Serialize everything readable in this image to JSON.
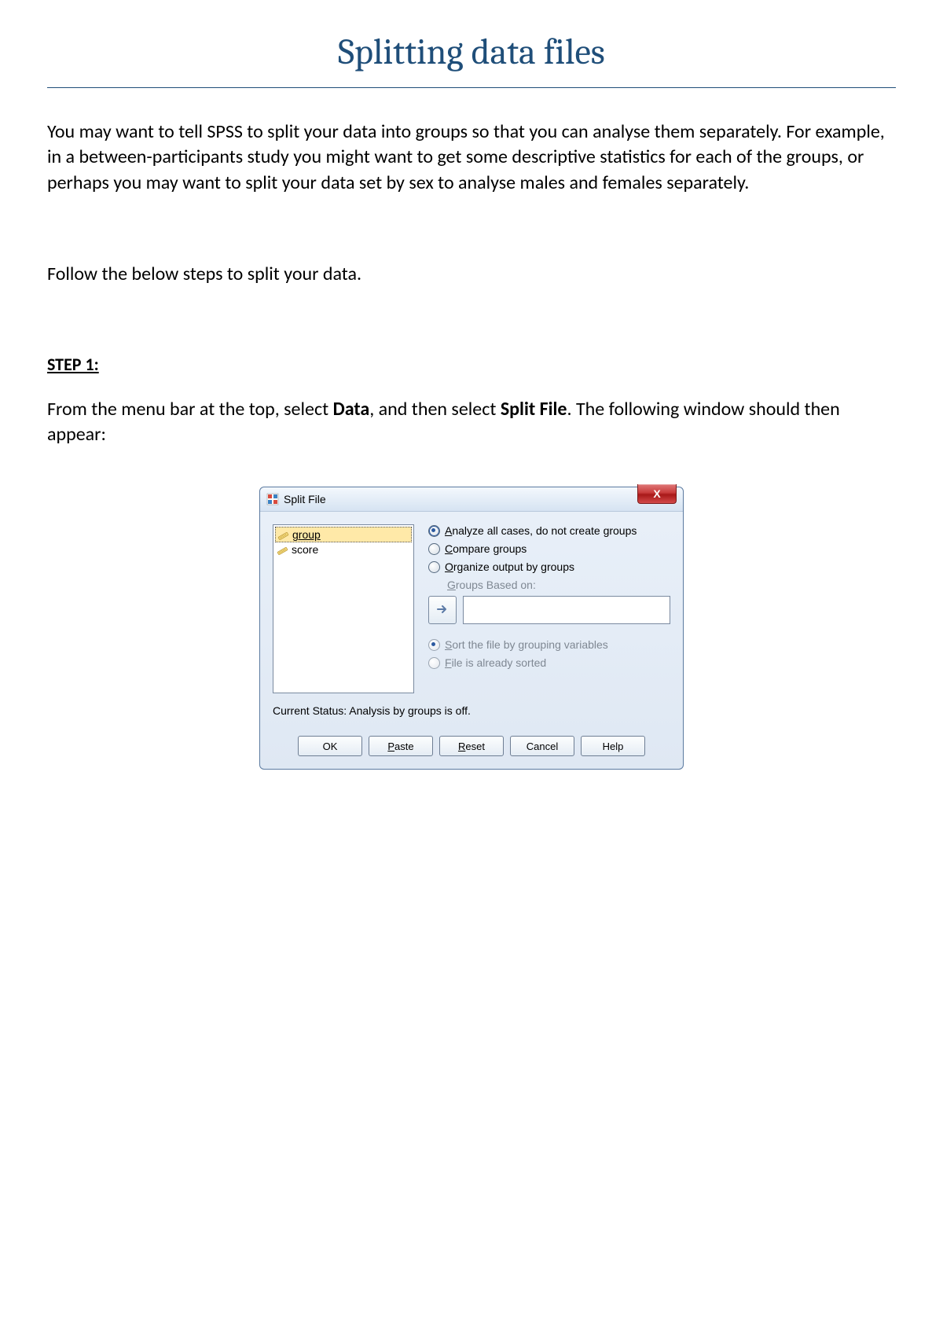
{
  "title": "Splitting data files",
  "intro_para": "You may want to tell SPSS to split your data into groups so that you can analyse them separately.  For example, in a between-participants study you might want to get some descriptive statistics for each of the groups, or perhaps you may want to split your data set by sex to analyse males and females separately.",
  "follow_para": "Follow the below steps to split your data.",
  "step1": {
    "heading": "STEP 1:",
    "body_pre": "From the menu bar at the top, select ",
    "bold1": "Data",
    "body_mid": ", and then select ",
    "bold2": "Split File",
    "body_post": ".  The following window should then appear:"
  },
  "dialog": {
    "title": "Split File",
    "close_label": "X",
    "variables": [
      "group",
      "score"
    ],
    "radios": {
      "analyze_all": "Analyze all cases, do not create groups",
      "compare": "Compare groups",
      "organize": "Organize output by groups"
    },
    "groups_based_on": "Groups Based on:",
    "sort_radio": "Sort the file by grouping variables",
    "already_sorted": "File is already sorted",
    "status": "Current Status: Analysis by groups is off.",
    "buttons": {
      "ok": "OK",
      "paste": "Paste",
      "reset": "Reset",
      "cancel": "Cancel",
      "help": "Help"
    }
  }
}
